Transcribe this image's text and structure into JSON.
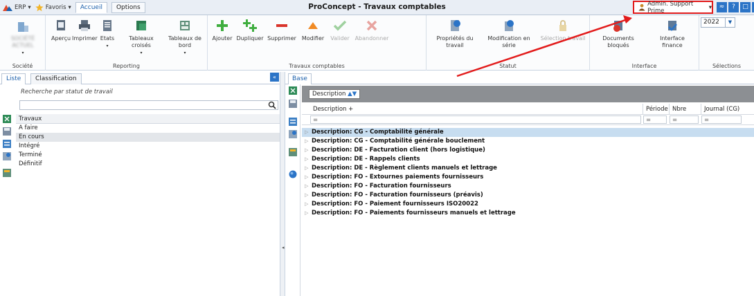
{
  "titlebar": {
    "erp_menu": "ERP",
    "favorites_menu": "Favoris",
    "tabs": [
      {
        "label": "Accueil"
      },
      {
        "label": "Options"
      }
    ],
    "title": "ProConcept - Travaux comptables",
    "user": "Admin. Support Prime",
    "window_buttons": [
      "≈",
      "?",
      "□",
      "✕"
    ]
  },
  "ribbon": {
    "groups": {
      "societe": {
        "label": "Société",
        "company_name": "SOCIÉTÉ ACTUEL"
      },
      "reporting": {
        "label": "Reporting",
        "buttons": [
          "Aperçu",
          "Imprimer",
          "Etats",
          "Tableaux croisés",
          "Tableaux de bord"
        ]
      },
      "travaux": {
        "label": "Travaux comptables",
        "buttons": [
          "Ajouter",
          "Dupliquer",
          "Supprimer",
          "Modifier",
          "Valider",
          "Abandonner"
        ]
      },
      "statut": {
        "label": "Statut",
        "buttons": [
          "Propriétés du travail",
          "Modification en série",
          "Sélection travail"
        ]
      },
      "interface": {
        "label": "Interface",
        "buttons": [
          "Documents bloqués",
          "Interface finance"
        ]
      },
      "selections": {
        "label": "Sélections",
        "year": "2022"
      }
    }
  },
  "left": {
    "tabs": [
      "Liste",
      "Classification"
    ],
    "search_label": "Recherche par statut de travail",
    "search_value": "",
    "list_header": "Travaux",
    "items": [
      "A faire",
      "En cours",
      "Intégré",
      "Terminé",
      "Définitif"
    ]
  },
  "right": {
    "tab": "Base",
    "group_chip": "Description",
    "headers": [
      "Description",
      "Période",
      "Nbre docu...",
      "Journal (CG)"
    ],
    "filter_symbol": "=",
    "rows": [
      "Description: CG - Comptabilité générale",
      "Description: CG - Comptabilité générale bouclement",
      "Description: DE - Facturation client (hors logistique)",
      "Description: DE - Rappels clients",
      "Description: DE - Règlement clients manuels et lettrage",
      "Description: FO - Extournes paiements fournisseurs",
      "Description: FO - Facturation fournisseurs",
      "Description: FO - Facturation fournisseurs (préavis)",
      "Description: FO - Paiement fournisseurs ISO20022",
      "Description: FO - Paiements fournisseurs manuels et lettrage"
    ]
  },
  "colors": {
    "accent": "#2b74c7",
    "highlight": "#e21b1b",
    "selected_row": "#c7ddf0",
    "group_bar": "#8c8f93"
  }
}
